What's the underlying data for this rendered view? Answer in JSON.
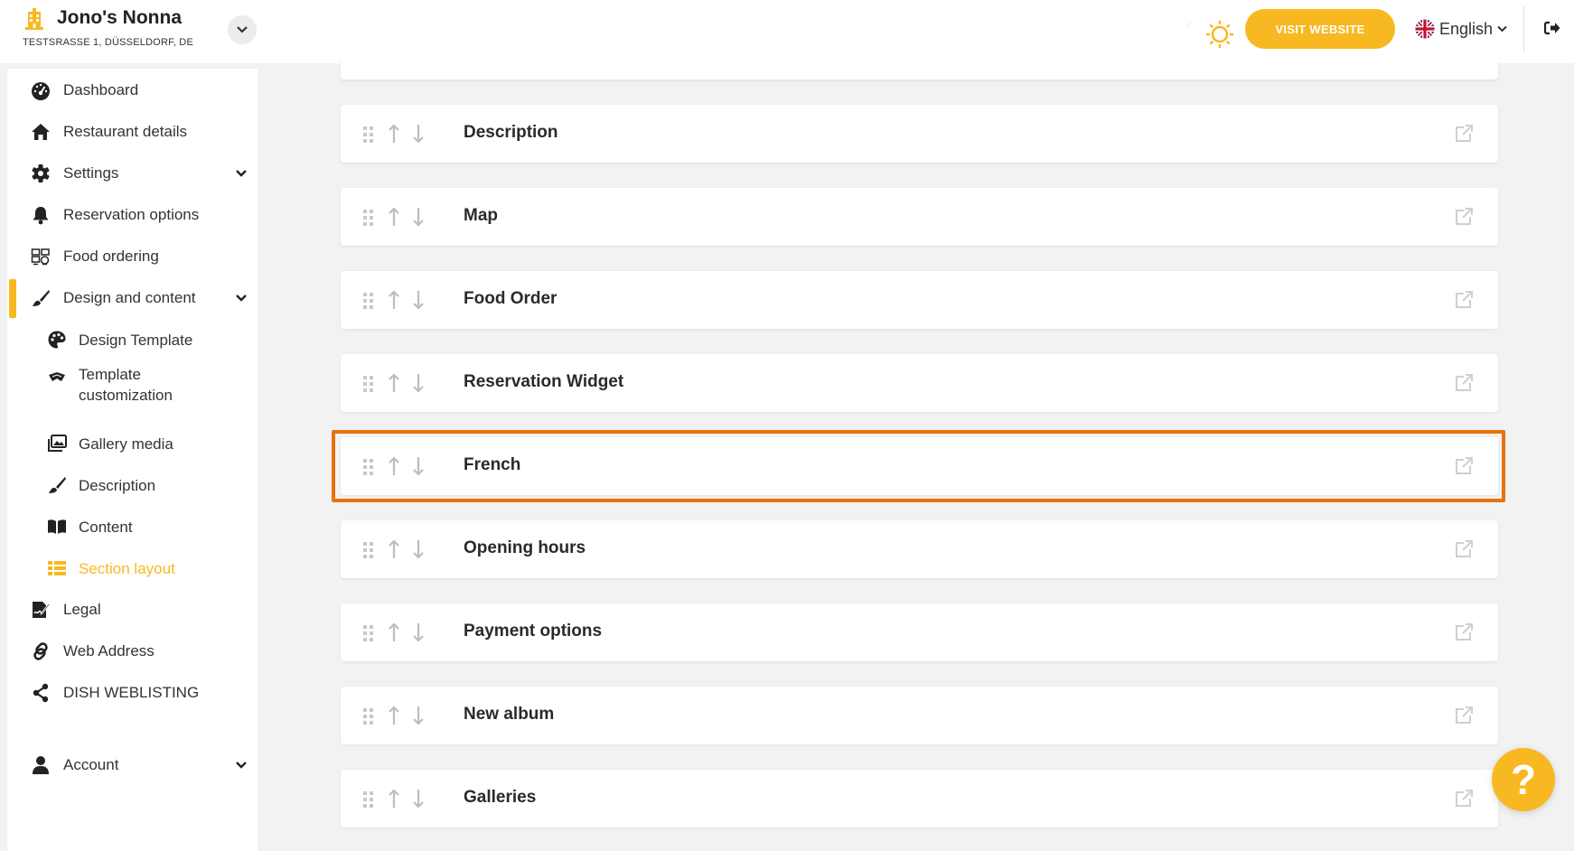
{
  "header": {
    "restaurant_name": "Jono's Nonna",
    "address": "TESTSRASSE 1, DÜSSELDORF, DE",
    "visit_website_label": "VISIT WEBSITE",
    "language": "English",
    "icons": [
      "building-icon",
      "chevron-down-icon",
      "moon-icon",
      "sun-icon",
      "uk-flag-icon",
      "logout-icon"
    ]
  },
  "colors": {
    "accent": "#f8b821",
    "highlight": "#e8720c",
    "background": "#f2f2f2"
  },
  "sidebar": {
    "items": [
      {
        "label": "Dashboard",
        "icon": "gauge-icon"
      },
      {
        "label": "Restaurant details",
        "icon": "home-icon"
      },
      {
        "label": "Settings",
        "icon": "gear-icon",
        "expandable": true
      },
      {
        "label": "Reservation options",
        "icon": "bell-icon"
      },
      {
        "label": "Food ordering",
        "icon": "food-ordering-icon"
      },
      {
        "label": "Design and content",
        "icon": "brush-icon",
        "expandable": true,
        "expanded": true
      },
      {
        "label": "Design Template",
        "icon": "palette-icon"
      },
      {
        "label": "Template customization",
        "icon": "template-icon"
      },
      {
        "label": "Gallery media",
        "icon": "images-icon"
      },
      {
        "label": "Description",
        "icon": "brush-icon"
      },
      {
        "label": "Content",
        "icon": "book-icon"
      },
      {
        "label": "Section layout",
        "icon": "list-icon",
        "active": true
      },
      {
        "label": "Legal",
        "icon": "signature-icon"
      },
      {
        "label": "Web Address",
        "icon": "link-icon"
      },
      {
        "label": "DISH WEBLISTING",
        "icon": "share-icon"
      },
      {
        "label": "Account",
        "icon": "user-icon",
        "expandable": true
      }
    ]
  },
  "sections": [
    {
      "title": "Description"
    },
    {
      "title": "Map"
    },
    {
      "title": "Food Order"
    },
    {
      "title": "Reservation Widget"
    },
    {
      "title": "French",
      "highlighted": true
    },
    {
      "title": "Opening hours"
    },
    {
      "title": "Payment options"
    },
    {
      "title": "New album"
    },
    {
      "title": "Galleries"
    }
  ],
  "help_label": "?"
}
